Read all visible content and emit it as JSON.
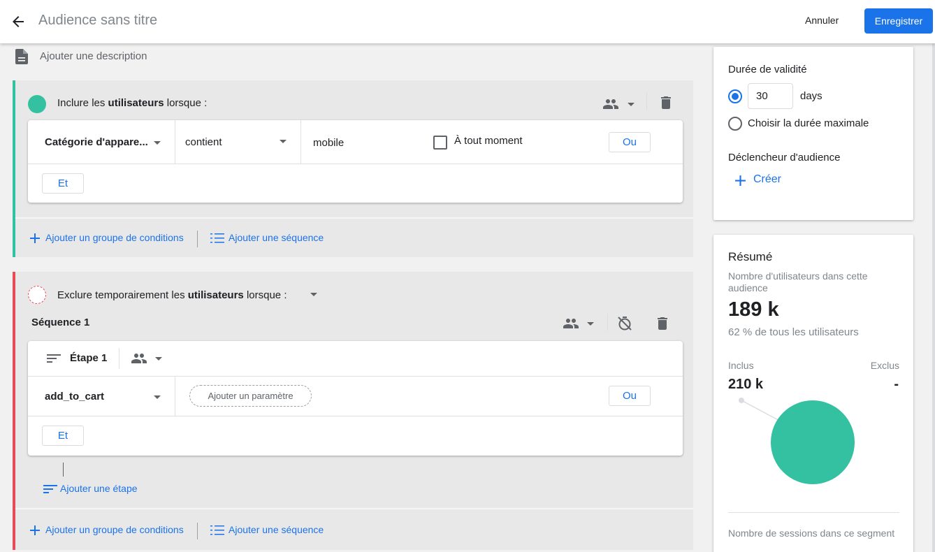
{
  "header": {
    "title": "Audience sans titre",
    "cancel_label": "Annuler",
    "save_label": "Enregistrer"
  },
  "description_placeholder": "Ajouter une description",
  "include_group": {
    "title_prefix": "Inclure les ",
    "title_bold": "utilisateurs",
    "title_suffix": " lorsque :",
    "condition": {
      "dimension": "Catégorie d'appare...",
      "operator": "contient",
      "value": "mobile",
      "checkbox_label": "À tout moment",
      "checkbox_checked": false,
      "or_label": "Ou"
    },
    "and_label": "Et",
    "add_condition_group": "Ajouter un groupe de conditions",
    "add_sequence": "Ajouter une séquence"
  },
  "exclude_group": {
    "title_prefix": "Exclure temporairement les ",
    "title_bold": "utilisateurs",
    "title_suffix": " lorsque :",
    "sequence_title": "Séquence 1",
    "step": {
      "label": "Étape 1",
      "event": "add_to_cart",
      "add_param": "Ajouter un paramètre",
      "or_label": "Ou",
      "and_label": "Et"
    },
    "add_step": "Ajouter une étape",
    "add_condition_group": "Ajouter un groupe de conditions",
    "add_sequence": "Ajouter une séquence"
  },
  "validity": {
    "title": "Durée de validité",
    "days_value": "30",
    "days_unit": "days",
    "max_duration_label": "Choisir la durée maximale",
    "selected": "days",
    "trigger_title": "Déclencheur d'audience",
    "create_label": "Créer"
  },
  "summary": {
    "title": "Résumé",
    "users_label": "Nombre d'utilisateurs dans cette audience",
    "users_value": "189 k",
    "users_share": "62 % de tous les utilisateurs",
    "included_label": "Inclus",
    "included_value": "210 k",
    "excluded_label": "Exclus",
    "excluded_value": "-",
    "sessions_label": "Nombre de sessions dans ce segment"
  },
  "colors": {
    "include": "#34c1a1",
    "exclude": "#ea4a54",
    "accent": "#1a73e8"
  }
}
